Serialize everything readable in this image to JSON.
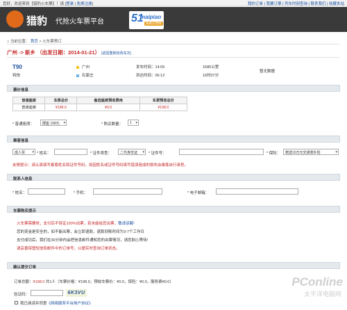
{
  "topbar": {
    "greeting": "您好，欢迎来到【猎豹火车票】！请",
    "login": "登录",
    "sep": "|",
    "register": "免费注册",
    "links": [
      "我的订单",
      "我要订票",
      "列车时刻查询",
      "联系我们",
      "收藏本站"
    ]
  },
  "header": {
    "brand": "猎豹",
    "brand_sub": "代抢火车票平台",
    "partner_num": "51",
    "partner_name": "maipiao",
    "partner_tag": "我要买票网"
  },
  "breadcrumb": {
    "prefix": "当前位置：",
    "home": "首页",
    "arrow": ">",
    "current": "火车票预订"
  },
  "route": {
    "text": "广州 -> 新乡 （出发日期：2014-01-21）",
    "change": "[返回重新抢改车次]"
  },
  "train": {
    "number": "T90",
    "type": "特快",
    "from": "广州",
    "to": "石家庄",
    "depart": "发车时间：14:05",
    "arrive": "到达时间：06:12",
    "distance": "1685公里",
    "duration": "16时07分",
    "remaining": "暂无数据",
    "from_color": "#f2c618",
    "to_color": "#68b4e8"
  },
  "price_section": {
    "title": "票价信息",
    "headers": [
      "普通座席",
      "车票总价",
      "备选座席预收费用",
      "车票预收总价"
    ],
    "row": [
      "普通座席",
      "¥198.0",
      "¥0.0",
      "¥198.0"
    ],
    "seat_label": "* 普通座席：",
    "seat_value": "硬座 198元",
    "count_label": "* 购买数量：",
    "count_value": "1"
  },
  "passenger_section": {
    "title": "乘客信息",
    "type_value": "成人票",
    "name_label": "* 姓名：",
    "idtype_label": "* 证件类型：",
    "idtype_value": "二代身份证",
    "idno_label": "* 证件号：",
    "insurance_label": "* 保险：",
    "insurance_value": "赠送10万元交通意外险",
    "warning": "友情提示：请认真填写乘客姓名和证件号码，如因姓名或证件号码填写错误造成的损失由乘客自行承担。"
  },
  "contact_section": {
    "title": "联系人信息",
    "name_label": "* 姓名：",
    "phone_label": "* 手机：",
    "email_label": "* 电子邮箱："
  },
  "tips_section": {
    "title": "车票购买提示",
    "lines": [
      {
        "text": "火车票需要抢，支付后不保证100%出票，若未能给您出票，",
        "link": "敬请谅解!",
        "red": true
      },
      {
        "text": "您的资金是安全的，如不能出票，会立即退款，退款到账时间为3-7个工作日",
        "red": false
      },
      {
        "text": "支付成功后，我们在30分钟内会把信息邮件通知您的出票情况，请您耐心等待!",
        "red": false
      },
      {
        "text": "请妥善保管短信和邮件中的订单号，以便实时查询订单状态。",
        "red": true
      }
    ]
  },
  "confirm_section": {
    "title": "确认提交订单",
    "total_label": "订单总额：",
    "total_value": "¥198.0",
    "total_rest": " 共1人（车票价格：¥198.0，预收车票价：¥0.0，保险：¥0.0，服务费¥0.0）",
    "captcha_label": "验证码：",
    "captcha_text": "6K3VU",
    "agree_text": "我已阅读并同意",
    "agree_link": "《网络服务平台用户协议》"
  },
  "watermark": {
    "brand": "PConline",
    "sub": "太平洋电脑网"
  }
}
